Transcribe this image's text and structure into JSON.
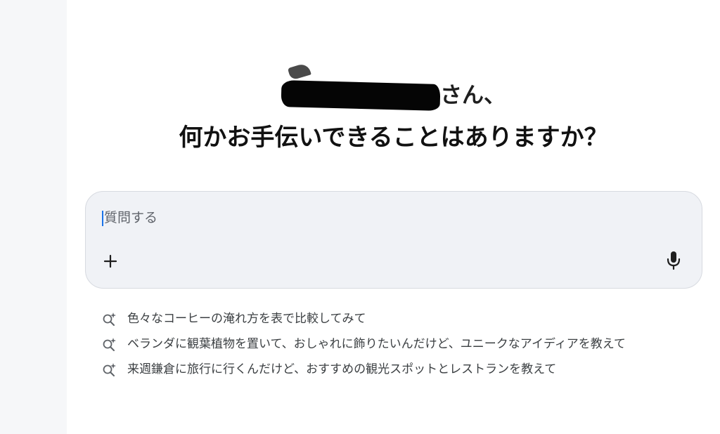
{
  "greeting": {
    "suffix": "さん、",
    "question": "何かお手伝いできることはありますか？"
  },
  "input": {
    "placeholder": "質問する",
    "value": ""
  },
  "icons": {
    "add": "plus-icon",
    "voice": "microphone-icon",
    "suggestion": "sparkle-search-icon"
  },
  "suggestions": [
    {
      "text": "色々なコーヒーの淹れ方を表で比較してみて"
    },
    {
      "text": "ベランダに観葉植物を置いて、おしゃれに飾りたいんだけど、ユニークなアイディアを教えて"
    },
    {
      "text": "来週鎌倉に旅行に行くんだけど、おすすめの観光スポットとレストランを教えて"
    }
  ],
  "colors": {
    "sidebar_bg": "#f6f7f9",
    "input_bg": "#f0f2f6",
    "caret": "#1a73e8",
    "text_primary": "#111111",
    "text_secondary": "#3c4043"
  }
}
